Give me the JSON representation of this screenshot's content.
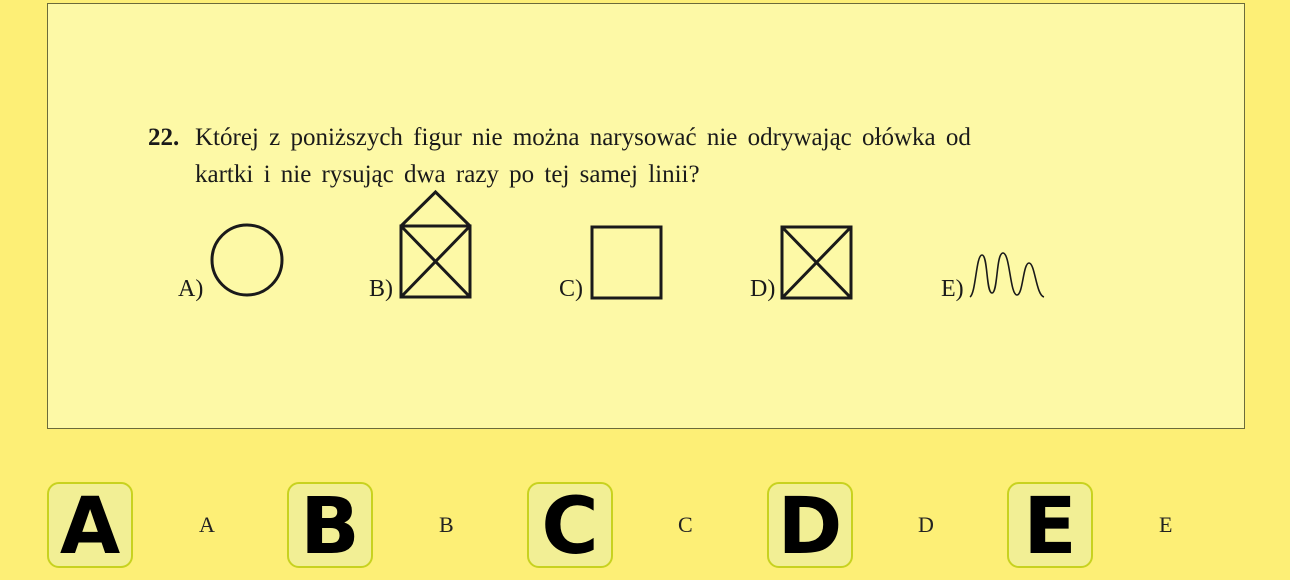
{
  "question": {
    "number": "22.",
    "line1": "Której z poniższych figur nie można narysować nie odrywając ołówka od",
    "line2": "kartki i nie rysując dwa razy po tej samej linii?"
  },
  "figures": [
    {
      "label": "A)",
      "shape": "circle-icon"
    },
    {
      "label": "B)",
      "shape": "house-envelope-icon"
    },
    {
      "label": "C)",
      "shape": "square-icon"
    },
    {
      "label": "D)",
      "shape": "crossed-square-icon"
    },
    {
      "label": "E)",
      "shape": "wave-icon"
    }
  ],
  "answers": [
    {
      "letter": "A",
      "caption": "A"
    },
    {
      "letter": "B",
      "caption": "B"
    },
    {
      "letter": "C",
      "caption": "C"
    },
    {
      "letter": "D",
      "caption": "D"
    },
    {
      "letter": "E",
      "caption": "E"
    }
  ],
  "colors": {
    "background": "#fdef76",
    "panel": "#fdf9a6",
    "tile": "#f2ef95",
    "tile_border": "#c8d21f"
  }
}
